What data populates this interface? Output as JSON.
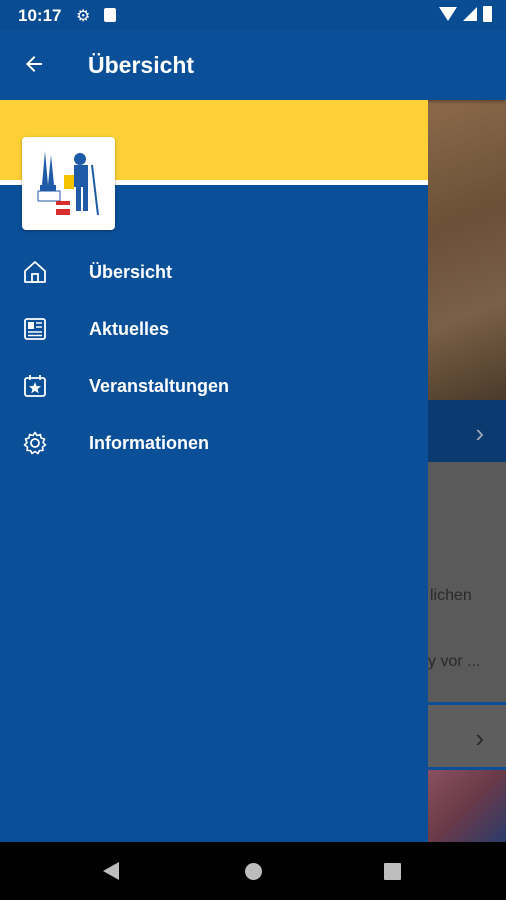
{
  "status_bar": {
    "time": "10:17",
    "icons": [
      "gear-icon",
      "sd-card-icon",
      "wifi-icon",
      "signal-icon",
      "battery-icon"
    ]
  },
  "app_bar": {
    "title": "Übersicht",
    "back_icon": "arrow-back-icon"
  },
  "drawer": {
    "header_color": "#fdd035",
    "logo": "city-logo",
    "items": [
      {
        "label": "Übersicht",
        "icon": "home-icon"
      },
      {
        "label": "Aktuelles",
        "icon": "newspaper-icon"
      },
      {
        "label": "Veranstaltungen",
        "icon": "calendar-star-icon"
      },
      {
        "label": "Informationen",
        "icon": "gear-icon"
      }
    ]
  },
  "background": {
    "text_1": "lichen",
    "text_2": "y vor ..."
  },
  "colors": {
    "primary": "#0b4f99",
    "accent": "#fdd035"
  }
}
